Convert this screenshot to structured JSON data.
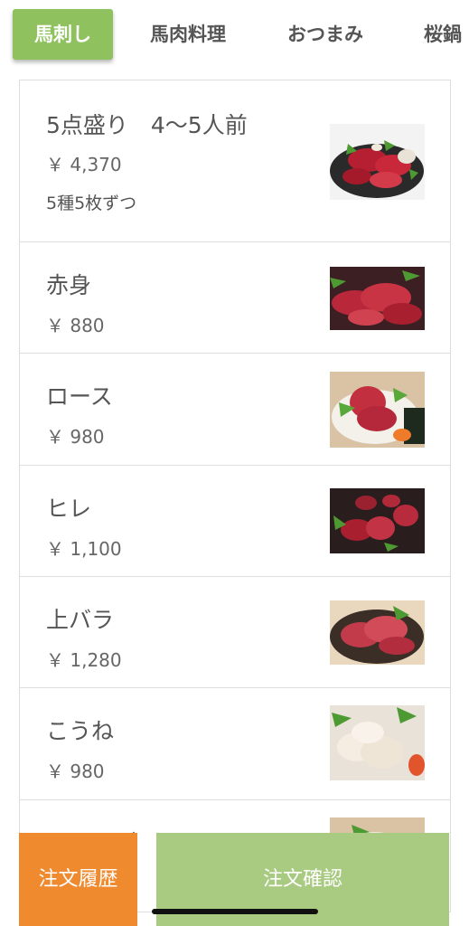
{
  "tabs": [
    {
      "label": "馬刺し",
      "active": true
    },
    {
      "label": "馬肉料理",
      "active": false
    },
    {
      "label": "おつまみ",
      "active": false
    },
    {
      "label": "桜鍋",
      "active": false
    }
  ],
  "items": [
    {
      "name": "5点盛り　4〜5人前",
      "price": "￥ 4,370",
      "note": "5種5枚ずつ",
      "image": "horse-sashimi-platter"
    },
    {
      "name": "赤身",
      "price": "￥ 880",
      "image": "lean-horse-sashimi"
    },
    {
      "name": "ロース",
      "price": "￥ 980",
      "image": "loin-horse-sashimi"
    },
    {
      "name": "ヒレ",
      "price": "￥ 1,100",
      "image": "fillet-horse-sashimi"
    },
    {
      "name": "上バラ",
      "price": "￥ 1,280",
      "image": "rib-horse-sashimi"
    },
    {
      "name": "こうね",
      "price": "￥ 980",
      "image": "kone-horse-sashimi"
    },
    {
      "name": "ふたえご",
      "price": "",
      "image": "futaego-horse-sashimi"
    }
  ],
  "footer": {
    "history_label": "注文履歴",
    "confirm_label": "注文確認"
  },
  "colors": {
    "active_tab": "#8fc15e",
    "history_button": "#ef8a2f",
    "confirm_button": "#a8cb81"
  }
}
